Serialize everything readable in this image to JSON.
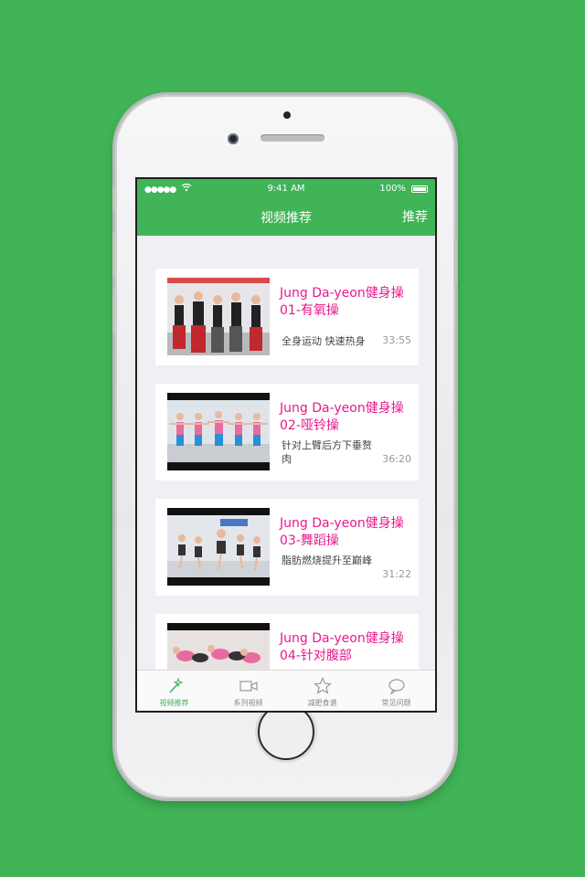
{
  "status_bar": {
    "signal": "●●●●●",
    "time": "9:41 AM",
    "battery": "100%"
  },
  "header": {
    "title": "视频推荐",
    "right_action": "推荐"
  },
  "videos": [
    {
      "title": "Jung Da-yeon健身操01-有氧操",
      "desc": "全身运动 快速热身",
      "duration": "33:55"
    },
    {
      "title": "Jung Da-yeon健身操02-哑铃操",
      "desc": "针对上臂后方下垂赘肉",
      "duration": "36:20"
    },
    {
      "title": "Jung Da-yeon健身操03-舞蹈操",
      "desc": "脂肪燃烧提升至巅峰",
      "duration": "31:22"
    },
    {
      "title": "Jung Da-yeon健身操04-针对腹部",
      "desc": "",
      "duration": ""
    }
  ],
  "tabs": [
    {
      "label": "视频推荐",
      "icon": "magic-wand-icon"
    },
    {
      "label": "系列视频",
      "icon": "video-camera-icon"
    },
    {
      "label": "减肥食谱",
      "icon": "star-icon"
    },
    {
      "label": "常见问题",
      "icon": "chat-bubble-icon"
    }
  ],
  "colors": {
    "accent": "#40b456",
    "title": "#e8198c"
  }
}
